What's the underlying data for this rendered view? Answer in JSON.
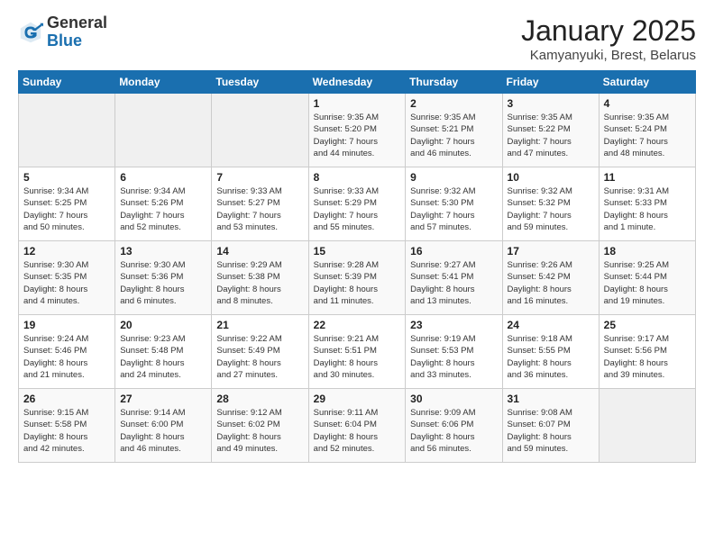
{
  "brand": {
    "name_general": "General",
    "name_blue": "Blue"
  },
  "header": {
    "title": "January 2025",
    "subtitle": "Kamyanyuki, Brest, Belarus"
  },
  "weekdays": [
    "Sunday",
    "Monday",
    "Tuesday",
    "Wednesday",
    "Thursday",
    "Friday",
    "Saturday"
  ],
  "weeks": [
    [
      {
        "day": "",
        "info": ""
      },
      {
        "day": "",
        "info": ""
      },
      {
        "day": "",
        "info": ""
      },
      {
        "day": "1",
        "info": "Sunrise: 9:35 AM\nSunset: 5:20 PM\nDaylight: 7 hours\nand 44 minutes."
      },
      {
        "day": "2",
        "info": "Sunrise: 9:35 AM\nSunset: 5:21 PM\nDaylight: 7 hours\nand 46 minutes."
      },
      {
        "day": "3",
        "info": "Sunrise: 9:35 AM\nSunset: 5:22 PM\nDaylight: 7 hours\nand 47 minutes."
      },
      {
        "day": "4",
        "info": "Sunrise: 9:35 AM\nSunset: 5:24 PM\nDaylight: 7 hours\nand 48 minutes."
      }
    ],
    [
      {
        "day": "5",
        "info": "Sunrise: 9:34 AM\nSunset: 5:25 PM\nDaylight: 7 hours\nand 50 minutes."
      },
      {
        "day": "6",
        "info": "Sunrise: 9:34 AM\nSunset: 5:26 PM\nDaylight: 7 hours\nand 52 minutes."
      },
      {
        "day": "7",
        "info": "Sunrise: 9:33 AM\nSunset: 5:27 PM\nDaylight: 7 hours\nand 53 minutes."
      },
      {
        "day": "8",
        "info": "Sunrise: 9:33 AM\nSunset: 5:29 PM\nDaylight: 7 hours\nand 55 minutes."
      },
      {
        "day": "9",
        "info": "Sunrise: 9:32 AM\nSunset: 5:30 PM\nDaylight: 7 hours\nand 57 minutes."
      },
      {
        "day": "10",
        "info": "Sunrise: 9:32 AM\nSunset: 5:32 PM\nDaylight: 7 hours\nand 59 minutes."
      },
      {
        "day": "11",
        "info": "Sunrise: 9:31 AM\nSunset: 5:33 PM\nDaylight: 8 hours\nand 1 minute."
      }
    ],
    [
      {
        "day": "12",
        "info": "Sunrise: 9:30 AM\nSunset: 5:35 PM\nDaylight: 8 hours\nand 4 minutes."
      },
      {
        "day": "13",
        "info": "Sunrise: 9:30 AM\nSunset: 5:36 PM\nDaylight: 8 hours\nand 6 minutes."
      },
      {
        "day": "14",
        "info": "Sunrise: 9:29 AM\nSunset: 5:38 PM\nDaylight: 8 hours\nand 8 minutes."
      },
      {
        "day": "15",
        "info": "Sunrise: 9:28 AM\nSunset: 5:39 PM\nDaylight: 8 hours\nand 11 minutes."
      },
      {
        "day": "16",
        "info": "Sunrise: 9:27 AM\nSunset: 5:41 PM\nDaylight: 8 hours\nand 13 minutes."
      },
      {
        "day": "17",
        "info": "Sunrise: 9:26 AM\nSunset: 5:42 PM\nDaylight: 8 hours\nand 16 minutes."
      },
      {
        "day": "18",
        "info": "Sunrise: 9:25 AM\nSunset: 5:44 PM\nDaylight: 8 hours\nand 19 minutes."
      }
    ],
    [
      {
        "day": "19",
        "info": "Sunrise: 9:24 AM\nSunset: 5:46 PM\nDaylight: 8 hours\nand 21 minutes."
      },
      {
        "day": "20",
        "info": "Sunrise: 9:23 AM\nSunset: 5:48 PM\nDaylight: 8 hours\nand 24 minutes."
      },
      {
        "day": "21",
        "info": "Sunrise: 9:22 AM\nSunset: 5:49 PM\nDaylight: 8 hours\nand 27 minutes."
      },
      {
        "day": "22",
        "info": "Sunrise: 9:21 AM\nSunset: 5:51 PM\nDaylight: 8 hours\nand 30 minutes."
      },
      {
        "day": "23",
        "info": "Sunrise: 9:19 AM\nSunset: 5:53 PM\nDaylight: 8 hours\nand 33 minutes."
      },
      {
        "day": "24",
        "info": "Sunrise: 9:18 AM\nSunset: 5:55 PM\nDaylight: 8 hours\nand 36 minutes."
      },
      {
        "day": "25",
        "info": "Sunrise: 9:17 AM\nSunset: 5:56 PM\nDaylight: 8 hours\nand 39 minutes."
      }
    ],
    [
      {
        "day": "26",
        "info": "Sunrise: 9:15 AM\nSunset: 5:58 PM\nDaylight: 8 hours\nand 42 minutes."
      },
      {
        "day": "27",
        "info": "Sunrise: 9:14 AM\nSunset: 6:00 PM\nDaylight: 8 hours\nand 46 minutes."
      },
      {
        "day": "28",
        "info": "Sunrise: 9:12 AM\nSunset: 6:02 PM\nDaylight: 8 hours\nand 49 minutes."
      },
      {
        "day": "29",
        "info": "Sunrise: 9:11 AM\nSunset: 6:04 PM\nDaylight: 8 hours\nand 52 minutes."
      },
      {
        "day": "30",
        "info": "Sunrise: 9:09 AM\nSunset: 6:06 PM\nDaylight: 8 hours\nand 56 minutes."
      },
      {
        "day": "31",
        "info": "Sunrise: 9:08 AM\nSunset: 6:07 PM\nDaylight: 8 hours\nand 59 minutes."
      },
      {
        "day": "",
        "info": ""
      }
    ]
  ]
}
